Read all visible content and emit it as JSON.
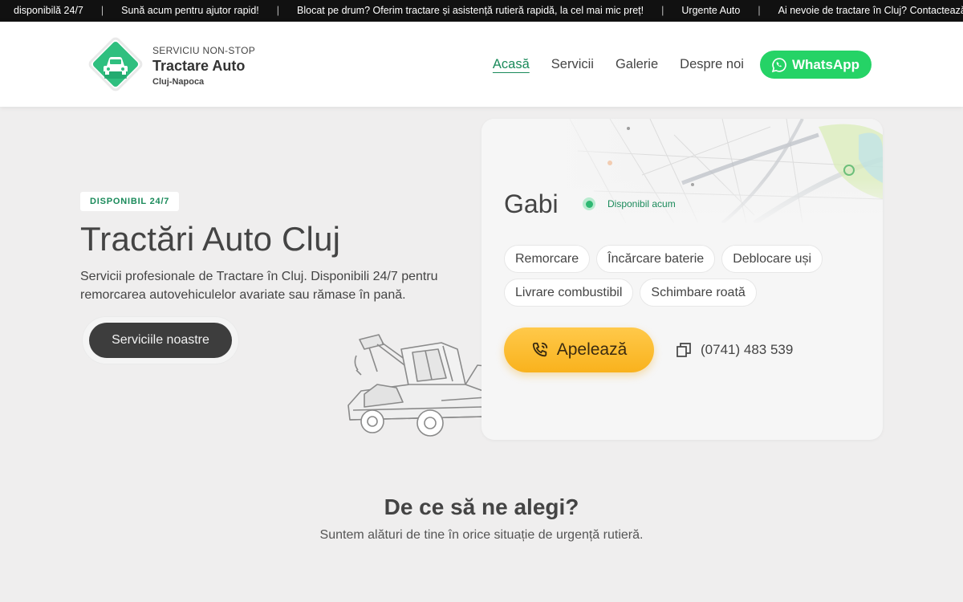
{
  "ticker": [
    "disponibilă 24/7",
    "Sună acum pentru ajutor rapid!",
    "Blocat pe drum? Oferim tractare și asistență rutieră rapidă, la cel mai mic preț!",
    "Urgente Auto",
    "Ai nevoie de tractare în Cluj? Contactează-ne"
  ],
  "ticker_separator": "|",
  "brand": {
    "kicker": "SERVICIU NON-STOP",
    "title": "Tractare Auto",
    "city": "Cluj-Napoca",
    "logo_icon": "car-icon",
    "color": "#22b573"
  },
  "nav": {
    "items": [
      "Acasă",
      "Servicii",
      "Galerie",
      "Despre noi"
    ],
    "active": "Acasă",
    "whatsapp_label": "WhatsApp",
    "whatsapp_color": "#25d366"
  },
  "hero": {
    "badge": "DISPONIBIL 24/7",
    "title": "Tractări Auto Cluj",
    "description": "Servicii profesionale de Tractare în Cluj. Disponibili 24/7 pentru remorcarea autovehiculelor avariate sau rămase în pană.",
    "cta_label": "Serviciile noastre",
    "illustration": "tow-truck-illustration"
  },
  "driver_card": {
    "name": "Gabi",
    "status": "Disponibil acum",
    "status_color": "#2eb872",
    "tags": [
      "Remorcare",
      "Încărcare baterie",
      "Deblocare uși",
      "Livrare combustibil",
      "Schimbare roată"
    ],
    "call_label": "Apelează",
    "call_icon": "phone-call-icon",
    "phone": "(0741) 483 539",
    "copy_icon": "copy-icon",
    "accent": "#f9b21d"
  },
  "why": {
    "title": "De ce să ne alegi?",
    "subtitle": "Suntem alături de tine în orice situație de urgență rutieră."
  }
}
